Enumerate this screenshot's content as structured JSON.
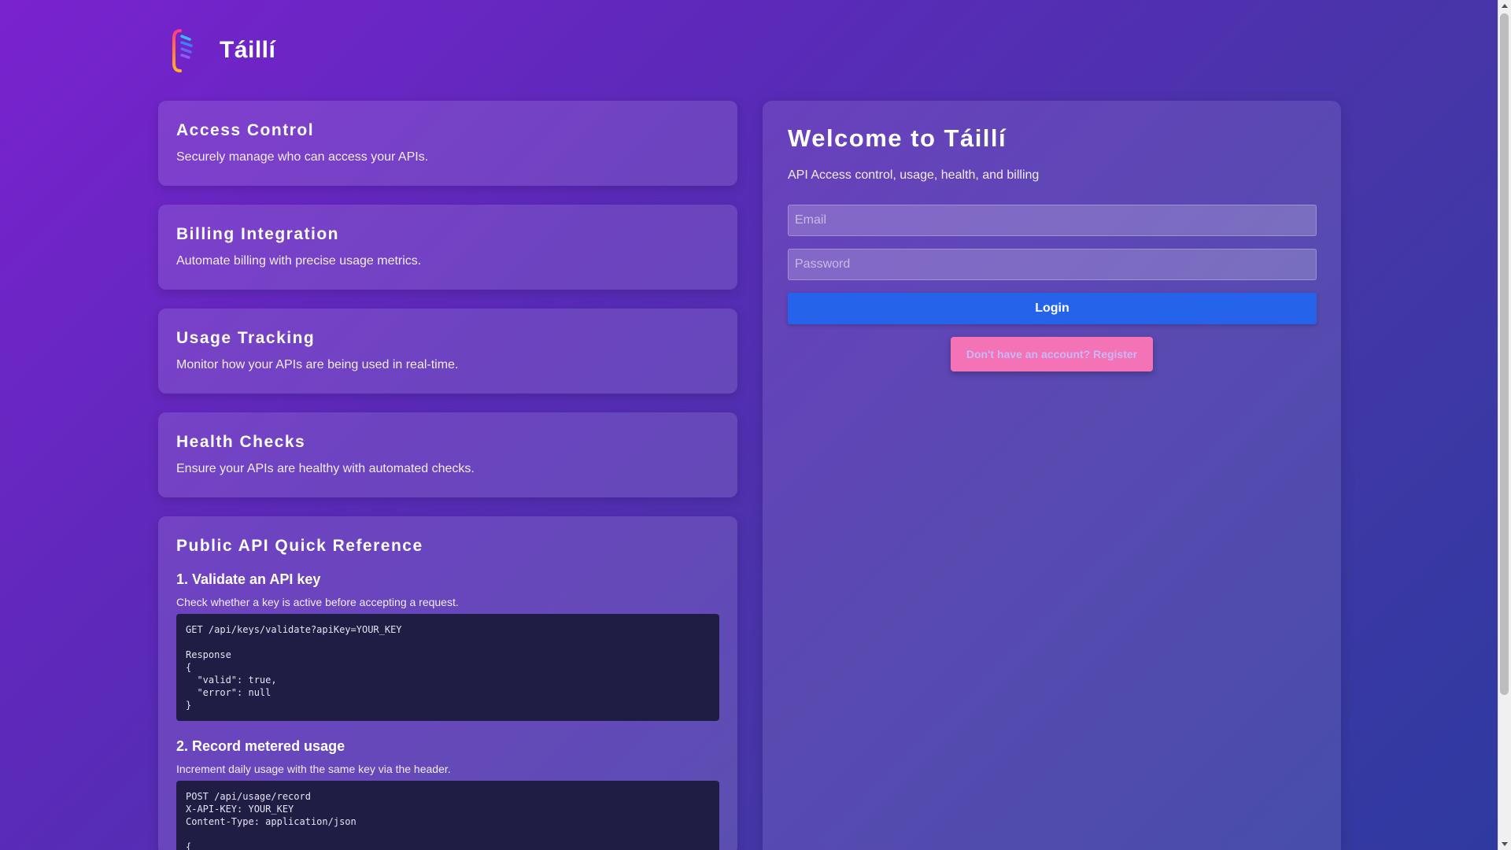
{
  "brand": {
    "name": "Táillí"
  },
  "features": [
    {
      "title": "Access Control",
      "description": "Securely manage who can access your APIs."
    },
    {
      "title": "Billing Integration",
      "description": "Automate billing with precise usage metrics."
    },
    {
      "title": "Usage Tracking",
      "description": "Monitor how your APIs are being used in real-time."
    },
    {
      "title": "Health Checks",
      "description": "Ensure your APIs are healthy with automated checks."
    }
  ],
  "api_reference": {
    "title": "Public API Quick Reference",
    "steps": [
      {
        "title": "1. Validate an API key",
        "description": "Check whether a key is active before accepting a request.",
        "code": "GET /api/keys/validate?apiKey=YOUR_KEY\n\nResponse\n{\n  \"valid\": true,\n  \"error\": null\n}"
      },
      {
        "title": "2. Record metered usage",
        "description": "Increment daily usage with the same key via the header.",
        "code": "POST /api/usage/record\nX-API-KEY: YOUR_KEY\nContent-Type: application/json\n\n{"
      }
    ]
  },
  "login": {
    "title": "Welcome to Táillí",
    "subtitle": "API Access control, usage, health, and billing",
    "email_placeholder": "Email",
    "email_value": "",
    "password_placeholder": "Password",
    "password_value": "",
    "login_label": "Login",
    "register_label": "Don't have an account? Register"
  },
  "colors": {
    "background_start": "#7a22cf",
    "background_end": "#2e3aa0",
    "login_button": "#2563eb",
    "register_button": "#f472b6",
    "code_background": "#1f1d44"
  },
  "icons": {
    "logo": "brand-logo-icon"
  }
}
